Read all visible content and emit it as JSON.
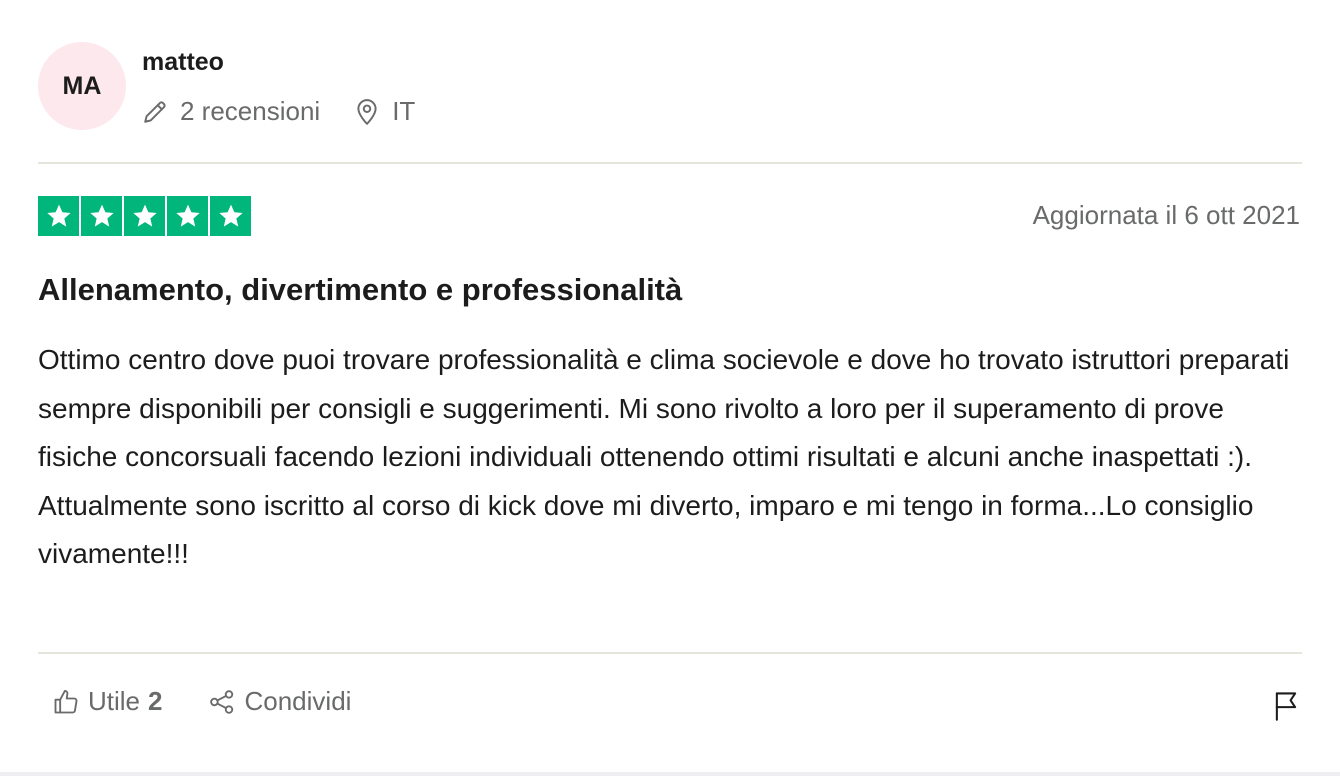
{
  "consumer": {
    "initials": "MA",
    "name": "matteo",
    "reviews_count": "2 recensioni",
    "country": "IT",
    "avatar_bg": "#fde8ee"
  },
  "review": {
    "rating": 5,
    "rating_color": "#00b67a",
    "date": "Aggiornata il 6 ott 2021",
    "title": "Allenamento, divertimento e professionalità",
    "body": "Ottimo centro dove puoi trovare professionalità e clima socievole e dove ho trovato istruttori preparati sempre disponibili per consigli e suggerimenti. Mi sono rivolto a loro per il superamento di prove fisiche concorsuali facendo lezioni individuali ottenendo ottimi risultati e alcuni anche inaspettati :). Attualmente sono iscritto al corso di kick dove mi diverto, imparo e mi tengo in forma...Lo consiglio vivamente!!!"
  },
  "actions": {
    "useful_label": "Utile",
    "useful_count": "2",
    "share_label": "Condividi"
  },
  "icons": {
    "reviews": "pencil-icon",
    "country": "location-pin-icon",
    "useful": "thumbs-up-icon",
    "share": "share-icon",
    "report": "flag-icon",
    "star": "star-icon"
  }
}
